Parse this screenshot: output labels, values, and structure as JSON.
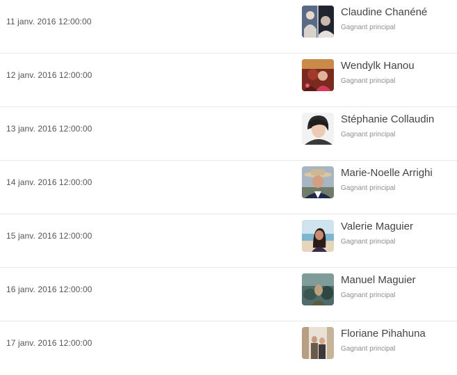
{
  "winners": [
    {
      "date": "11 janv. 2016 12:00:00",
      "name": "Claudine Chanéné",
      "role": "Gagnant principal"
    },
    {
      "date": "12 janv. 2016 12:00:00",
      "name": "Wendylk Hanou",
      "role": "Gagnant principal"
    },
    {
      "date": "13 janv. 2016 12:00:00",
      "name": "Stéphanie Collaudin",
      "role": "Gagnant principal"
    },
    {
      "date": "14 janv. 2016 12:00:00",
      "name": "Marie-Noelle Arrighi",
      "role": "Gagnant principal"
    },
    {
      "date": "15 janv. 2016 12:00:00",
      "name": "Valerie Maguier",
      "role": "Gagnant principal"
    },
    {
      "date": "16 janv. 2016 12:00:00",
      "name": "Manuel Maguier",
      "role": "Gagnant principal"
    },
    {
      "date": "17 janv. 2016 12:00:00",
      "name": "Floriane Pihahuna",
      "role": "Gagnant principal"
    }
  ]
}
